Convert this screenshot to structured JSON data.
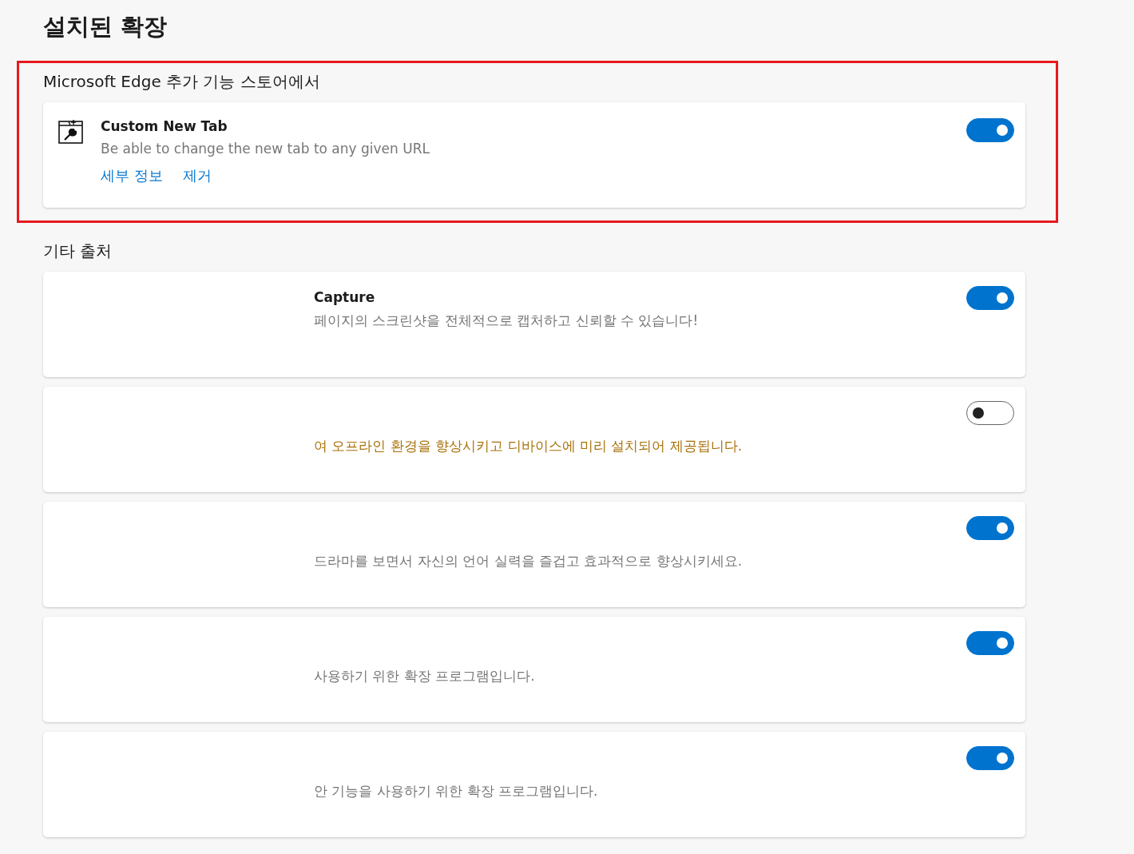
{
  "title": "설치된 확장",
  "store_section": {
    "heading": "Microsoft Edge 추가 기능 스토어에서",
    "highlighted": true,
    "extensions": [
      {
        "name": "Custom New Tab",
        "description": "Be able to change the new tab to any given URL",
        "links": [
          "세부 정보",
          "제거"
        ],
        "on": true
      }
    ]
  },
  "other_section": {
    "heading": "기타 출처",
    "extensions": [
      {
        "name": "Capture",
        "description": "페이지의 스크린샷을 전체적으로 캡처하고 신뢰할 수 있습니다!",
        "warning": false,
        "on": true
      },
      {
        "description": "여 오프라인 환경을 향상시키고 디바이스에 미리 설치되어 제공됩니다.",
        "warning": true,
        "on": false
      },
      {
        "description": "드라마를 보면서 자신의 언어 실력을 즐겁고 효과적으로 향상시키세요.",
        "warning": false,
        "on": true
      },
      {
        "description": "사용하기 위한 확장 프로그램입니다.",
        "warning": false,
        "on": true
      },
      {
        "description": "안 기능을 사용하기 위한 확장 프로그램입니다.",
        "warning": false,
        "on": true
      }
    ]
  }
}
